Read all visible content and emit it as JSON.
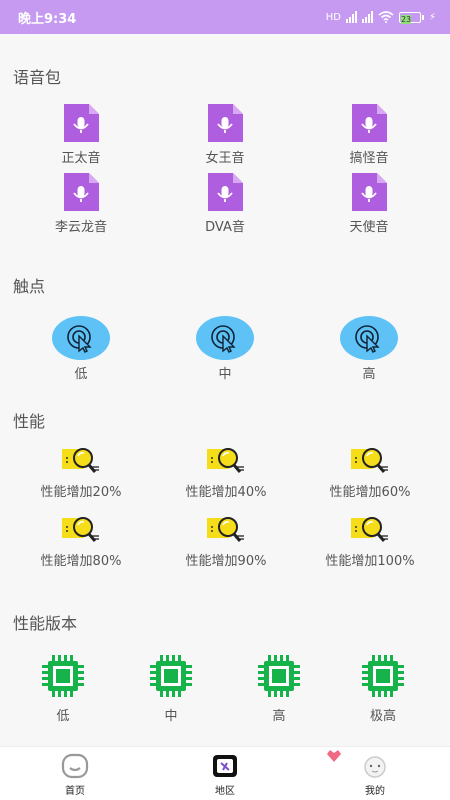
{
  "status_bar": {
    "time": "晚上9:34",
    "network": "HD",
    "battery": "23"
  },
  "sections": {
    "voice_pack": {
      "title": "语音包",
      "items": [
        "正太音",
        "女王音",
        "搞怪音",
        "李云龙音",
        "DVA音",
        "天使音"
      ]
    },
    "touch": {
      "title": "触点",
      "items": [
        "低",
        "中",
        "高"
      ]
    },
    "performance": {
      "title": "性能",
      "items": [
        "性能增加20%",
        "性能增加40%",
        "性能增加60%",
        "性能增加80%",
        "性能增加90%",
        "性能增加100%"
      ]
    },
    "performance_version": {
      "title": "性能版本",
      "items": [
        "低",
        "中",
        "高",
        "极高"
      ]
    }
  },
  "tabs": {
    "home": "首页",
    "region": "地区",
    "mine": "我的"
  },
  "colors": {
    "status_bar": "#c59af0",
    "voice_icon": "#b05ee0",
    "touch_circle": "#5ec2f7",
    "perf_icon": "#f5dd1a",
    "chip": "#16b34a"
  }
}
